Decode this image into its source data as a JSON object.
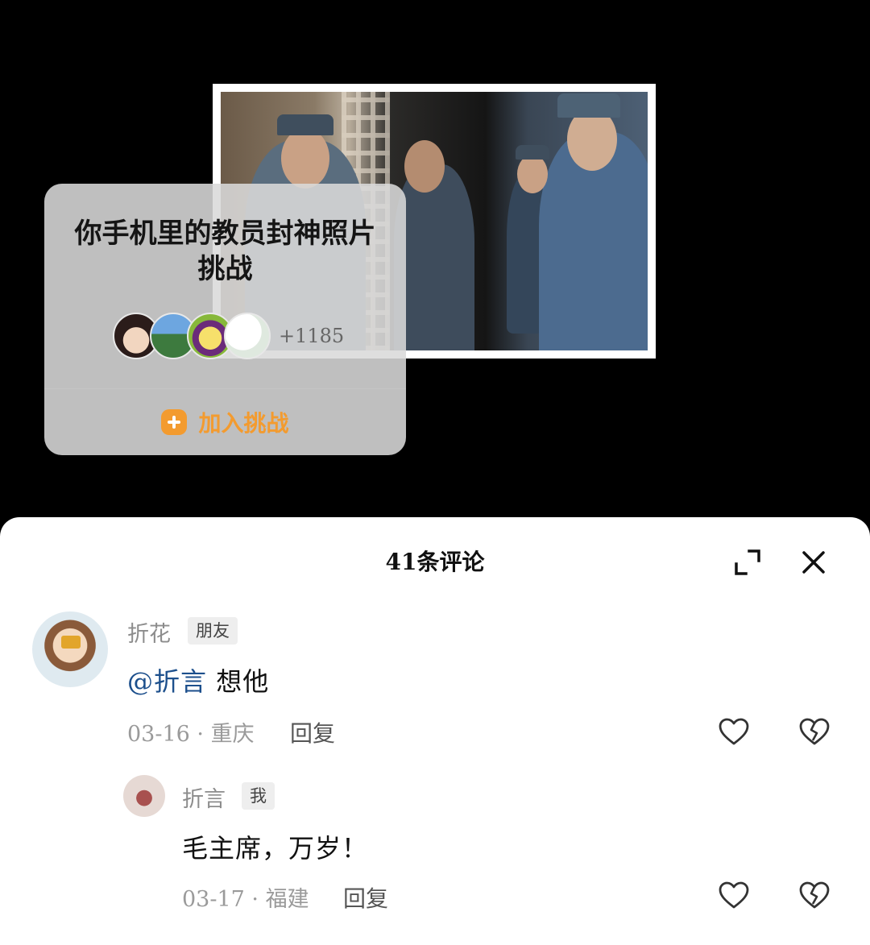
{
  "challenge": {
    "title": "你手机里的教员封神照片挑战",
    "participant_count": "+1185",
    "join_label": "加入挑战"
  },
  "comments_panel": {
    "title": "41条评论",
    "comments": [
      {
        "username": "折花",
        "tag": "朋友",
        "mention": "@折言",
        "text": " 想他",
        "meta": "03-16 · 重庆",
        "reply_label": "回复"
      },
      {
        "username": "折言",
        "tag": "我",
        "text": "毛主席，万岁！",
        "meta": "03-17 · 福建",
        "reply_label": "回复"
      }
    ]
  },
  "colors": {
    "accent_orange": "#f39b2f",
    "mention_blue": "#1c4f8c",
    "sheet_bg": "#ffffff",
    "video_bg": "#000000"
  },
  "icons": [
    "plus-icon",
    "expand-icon",
    "close-icon",
    "heart-icon",
    "broken-heart-icon"
  ]
}
